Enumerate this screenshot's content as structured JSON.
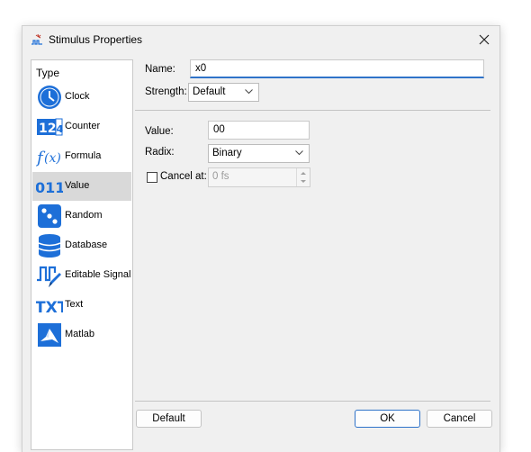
{
  "window": {
    "title": "Stimulus Properties"
  },
  "type_panel": {
    "heading": "Type",
    "items": [
      {
        "label": "Clock",
        "icon": "clock-icon"
      },
      {
        "label": "Counter",
        "icon": "counter-icon"
      },
      {
        "label": "Formula",
        "icon": "formula-icon"
      },
      {
        "label": "Value",
        "icon": "value-icon",
        "selected": true
      },
      {
        "label": "Random",
        "icon": "dice-icon"
      },
      {
        "label": "Database",
        "icon": "database-icon"
      },
      {
        "label": "Editable Signal",
        "icon": "editable-signal-icon"
      },
      {
        "label": "Text",
        "icon": "text-icon"
      },
      {
        "label": "Matlab",
        "icon": "matlab-icon"
      }
    ]
  },
  "form": {
    "name_label": "Name:",
    "name_value": "x0",
    "strength_label": "Strength:",
    "strength_value": "Default",
    "value_label": "Value:",
    "value_value": "00",
    "radix_label": "Radix:",
    "radix_value": "Binary",
    "cancel_label": "Cancel at:",
    "cancel_checked": false,
    "cancel_value": "0 fs"
  },
  "buttons": {
    "default": "Default",
    "ok": "OK",
    "cancel": "Cancel"
  },
  "colors": {
    "accent": "#2f73c9",
    "icon_blue": "#1d6fd8",
    "selected_bg": "#d9d9d9"
  }
}
